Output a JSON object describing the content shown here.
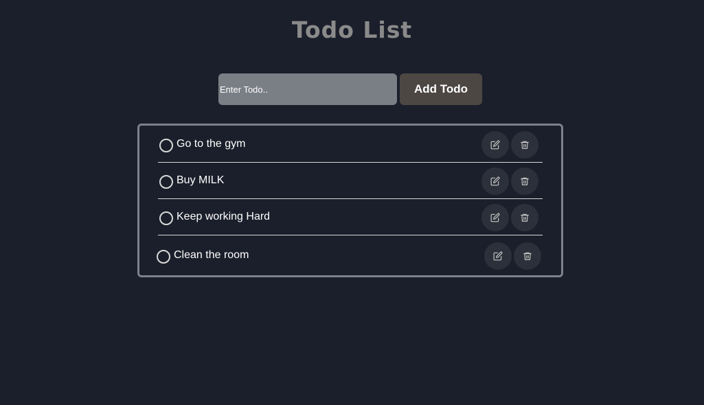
{
  "header": {
    "title": "Todo List"
  },
  "form": {
    "input_placeholder": "Enter Todo..",
    "input_value": "",
    "add_label": "Add Todo"
  },
  "todos": [
    {
      "text": "Go to the gym",
      "completed": false
    },
    {
      "text": "Buy MILK",
      "completed": false
    },
    {
      "text": "Keep working Hard",
      "completed": false
    },
    {
      "text": "Clean the room",
      "completed": false
    }
  ],
  "icons": {
    "toggle": "circle-icon",
    "edit": "edit-icon",
    "delete": "trash-icon"
  },
  "colors": {
    "background": "#1b1f2b",
    "title": "#8a8a8a",
    "input_bg": "#7a7f86",
    "button_bg": "#4d4744",
    "border": "#7d818c",
    "icon_button_bg": "#2c303a"
  }
}
